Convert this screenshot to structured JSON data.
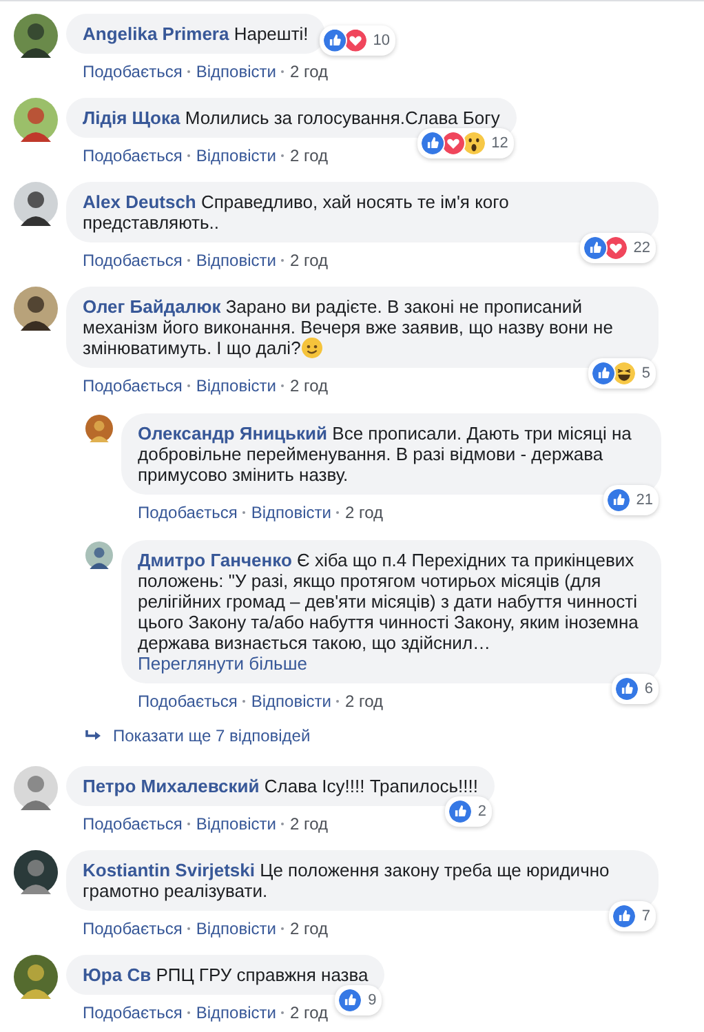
{
  "comments": [
    {
      "name": "Angelika Primera",
      "text": "Нарешті!",
      "reactions": [
        {
          "kind": "like"
        },
        {
          "kind": "love"
        }
      ],
      "count": "10",
      "like_label": "Подобається",
      "reply_label": "Відповісти",
      "time": "2 год"
    },
    {
      "name": "Лідія Щока",
      "text": "Молились за голосування.Слава Богу",
      "reactions": [
        {
          "kind": "like"
        },
        {
          "kind": "love"
        },
        {
          "kind": "wow"
        }
      ],
      "count": "12",
      "like_label": "Подобається",
      "reply_label": "Відповісти",
      "time": "2 год"
    },
    {
      "name": "Alex Deutsch",
      "text": "Справедливо, хай носять те ім'я кого представляють..",
      "reactions": [
        {
          "kind": "like"
        },
        {
          "kind": "love"
        }
      ],
      "count": "22",
      "like_label": "Подобається",
      "reply_label": "Відповісти",
      "time": "2 год"
    },
    {
      "name": "Олег Байдалюк",
      "text": "Зарано ви радієте. В законі не прописаний механізм його виконання. Вечеря вже заявив, що назву вони не змінюватимуть. І що далі?",
      "trailing_emoji": true,
      "reactions": [
        {
          "kind": "like"
        },
        {
          "kind": "haha"
        }
      ],
      "count": "5",
      "like_label": "Подобається",
      "reply_label": "Відповісти",
      "time": "2 год",
      "replies": [
        {
          "name": "Олександр Яницький",
          "text": "Все прописали. Дають три місяці на добровільне перейменування. В разі відмови - держава примусово змінить назву.",
          "reactions": [
            {
              "kind": "like"
            }
          ],
          "count": "21",
          "like_label": "Подобається",
          "reply_label": "Відповісти",
          "time": "2 год"
        },
        {
          "name": "Дмитро Ганченко",
          "text": "Є хіба що п.4 Перехідних та прикінцевих положень: \"У разі, якщо протягом чотирьох місяців (для релігійних громад – дев'яти місяців) з дати набуття чинності цього Закону та/або набуття чинності Закону, яким іноземна держава визнається такою, що здійснил…",
          "see_more": "Переглянути більше",
          "reactions": [
            {
              "kind": "like"
            }
          ],
          "count": "6",
          "like_label": "Подобається",
          "reply_label": "Відповісти",
          "time": "2 год"
        }
      ],
      "more_replies": "Показати ще 7 відповідей"
    },
    {
      "name": "Петро Михалевский",
      "text": "Слава Ісу!!!! Трапилось!!!!",
      "reactions": [
        {
          "kind": "like"
        }
      ],
      "count": "2",
      "like_label": "Подобається",
      "reply_label": "Відповісти",
      "time": "2 год"
    },
    {
      "name": "Kostiantin Svirjetski",
      "text": "Це положення закону треба ще юридично грамотно реалізувати.",
      "reactions": [
        {
          "kind": "like"
        }
      ],
      "count": "7",
      "like_label": "Подобається",
      "reply_label": "Відповісти",
      "time": "2 год"
    },
    {
      "name": "Юра Св",
      "text": "РПЦ ГРУ справжня назва",
      "reactions": [
        {
          "kind": "like"
        }
      ],
      "count": "9",
      "like_label": "Подобається",
      "reply_label": "Відповісти",
      "time": "2 год"
    }
  ]
}
